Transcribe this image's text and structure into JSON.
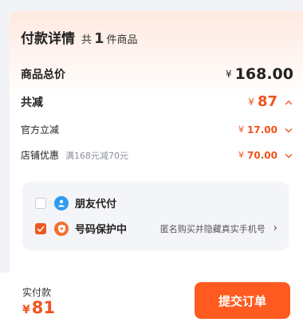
{
  "summary": {
    "title": "付款详情",
    "count_prefix": "共",
    "count": "1",
    "count_suffix": "件商品"
  },
  "lines": {
    "currency": "¥",
    "total_label": "商品总价",
    "total_amount": "168.00",
    "discount_label": "共减",
    "discount_amount": "87",
    "official_label": "官方立减",
    "official_amount": "17.00",
    "store_label": "店铺优惠",
    "store_hint": "满168元减70元",
    "store_amount": "70.00"
  },
  "options": {
    "friend_pay": {
      "label": "朋友代付",
      "checked": false,
      "icon": "friend-pay-icon"
    },
    "number_protect": {
      "label": "号码保护中",
      "checked": true,
      "icon": "shield-icon",
      "desc": "匿名购买并隐藏真实手机号",
      "arrow": "›"
    }
  },
  "footer": {
    "pay_label": "实付款",
    "currency": "¥",
    "pay_amount": "81",
    "submit_label": "提交订单"
  },
  "colors": {
    "accent": "#f2531e",
    "button": "#ff5a1f",
    "info_icon": "#2e9bf2"
  }
}
